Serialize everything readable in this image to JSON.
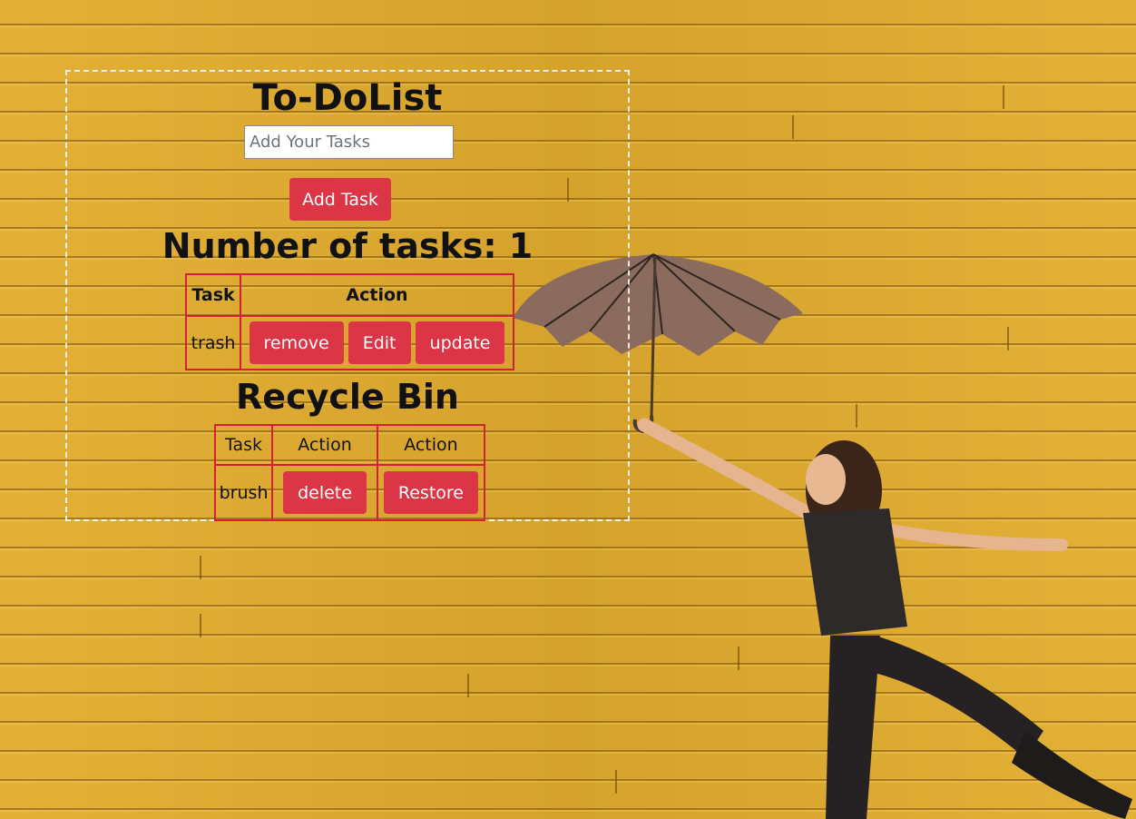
{
  "app": {
    "title": "To-DoList",
    "input_placeholder": "Add Your Tasks",
    "add_button": "Add Task",
    "count_label": "Number of tasks: 1"
  },
  "tasks_table": {
    "headers": [
      "Task",
      "Action"
    ],
    "rows": [
      {
        "task": "trash",
        "buttons": [
          "remove",
          "Edit",
          "update"
        ]
      }
    ]
  },
  "recycle_bin": {
    "title": "Recycle Bin",
    "headers": [
      "Task",
      "Action",
      "Action"
    ],
    "rows": [
      {
        "task": "brush",
        "delete": "delete",
        "restore": "Restore"
      }
    ]
  },
  "colors": {
    "accent": "#dc3545",
    "background": "#e2ad2f",
    "table_border": "#d61e36"
  }
}
